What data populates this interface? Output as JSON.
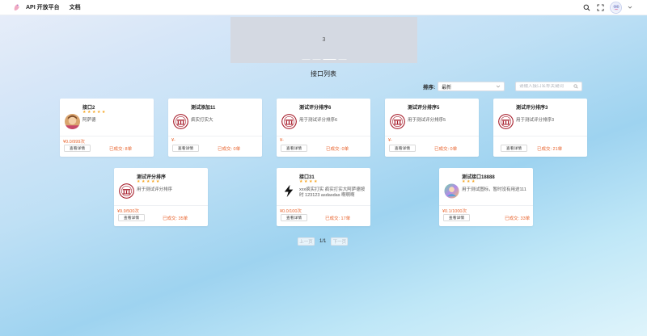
{
  "app": {
    "brand": "API 开放平台",
    "nav_doc": "文档",
    "icons": {
      "logo": "bird-logo-icon",
      "search": "search-icon",
      "fullscreen": "fullscreen-icon",
      "avatar": "user-avatar-icon"
    }
  },
  "carousel": {
    "current": "3"
  },
  "list": {
    "title": "接口列表",
    "sort_label": "排序:",
    "sort_value": "最新",
    "search_placeholder": "请输入接口名称关键词"
  },
  "cards": [
    {
      "title": "接口2",
      "stars": "★★★★★",
      "desc": "阿萨德",
      "price": "¥0.0/999次",
      "button": "查看详情",
      "deal": "已成交: 8单",
      "avatar": "photo-avatar"
    },
    {
      "title": "测试添加11",
      "stars": "",
      "desc": "疯实打实大",
      "price": "¥-",
      "button": "查看详情",
      "deal": "已成交: 0单",
      "avatar": "emblem-avatar"
    },
    {
      "title": "测试评分排序6",
      "stars": "",
      "desc": "用于测试评分排序6",
      "price": "¥-",
      "button": "查看详情",
      "deal": "已成交: 0单",
      "avatar": "emblem-avatar"
    },
    {
      "title": "测试评分排序5",
      "stars": "",
      "desc": "用于测试评分排序5",
      "price": "¥-",
      "button": "查看详情",
      "deal": "已成交: 0单",
      "avatar": "emblem-avatar"
    },
    {
      "title": "测试评分排序3",
      "stars": "",
      "desc": "用于测试评分排序3",
      "price": "",
      "button": "查看详情",
      "deal": "已成交: 21单",
      "avatar": "emblem-avatar"
    },
    {
      "title": "测试评分排序",
      "stars": "★★★★★",
      "desc": "用于测试评分排序",
      "price": "¥9.9/500次",
      "button": "查看详情",
      "deal": "已成交: 35单",
      "avatar": "emblem-avatar"
    },
    {
      "title": "接口31",
      "stars": "★★★★",
      "desc": "xxx疯实打实 疯实打实大阿萨德按时 123123 asdasdas 啊啊啊",
      "price": "¥0.0/100次",
      "button": "查看详情",
      "deal": "已成交: 17单",
      "avatar": "bolt-avatar"
    },
    {
      "title": "测试接口18888",
      "stars": "★★★",
      "desc": "用于测试图标，暂时没有用途111",
      "price": "¥0.1/1000次",
      "button": "查看详情",
      "deal": "已成交: 33单",
      "avatar": "colorful-avatar"
    }
  ],
  "pager": {
    "prev": "上一页",
    "info": "1/1",
    "next": "下一页"
  }
}
